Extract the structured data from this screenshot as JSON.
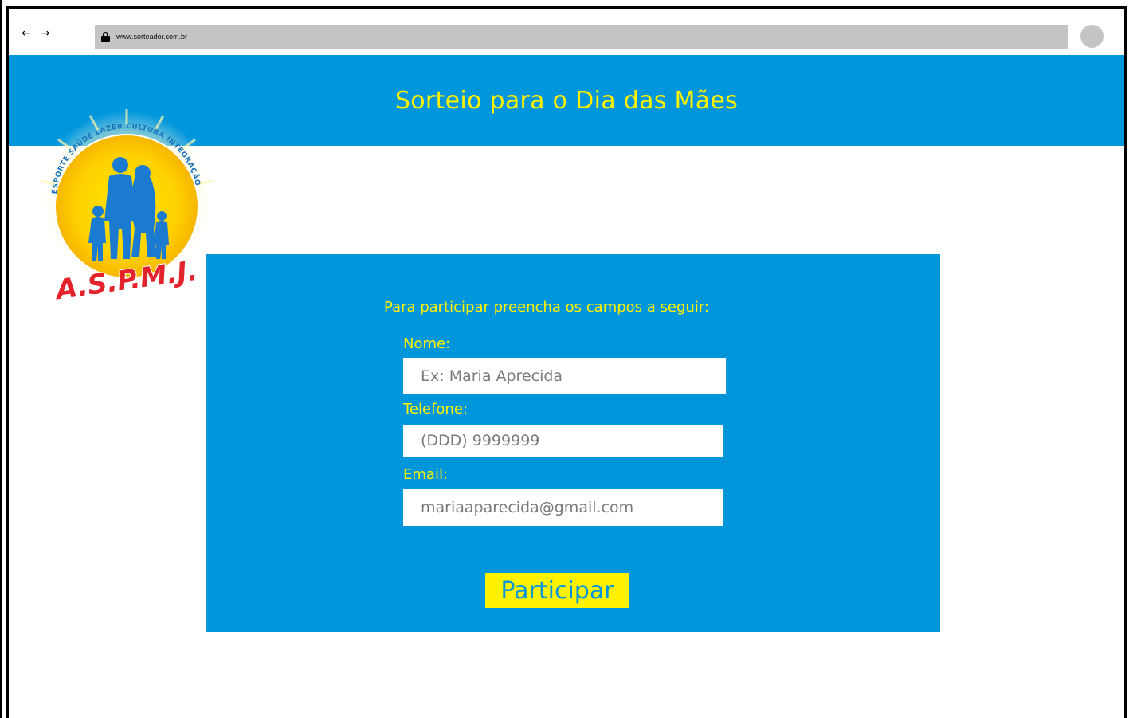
{
  "browser": {
    "back_icon": "←",
    "forward_icon": "→",
    "url": "www.sorteador.com.br"
  },
  "header": {
    "title": "Sorteio para o Dia das Mães"
  },
  "logo": {
    "top_arc_text": "ESPORTE SAÚDE LAZER CULTURA INTEGRAÇÃO",
    "letters": "A.S.P.M.J."
  },
  "form": {
    "intro": "Para participar preencha os campos a seguir:",
    "name_label": "Nome:",
    "name_placeholder": "Ex: Maria Aprecida",
    "phone_label": "Telefone:",
    "phone_placeholder": "(DDD) 9999999",
    "email_label": "Email:",
    "email_placeholder": "mariaaparecida@gmail.com",
    "submit_label": "Participar"
  },
  "colors": {
    "primary_blue": "#0096db",
    "accent_yellow": "#fff200",
    "url_bar_gray": "#c4c4c4",
    "logo_red": "#e3232b"
  }
}
